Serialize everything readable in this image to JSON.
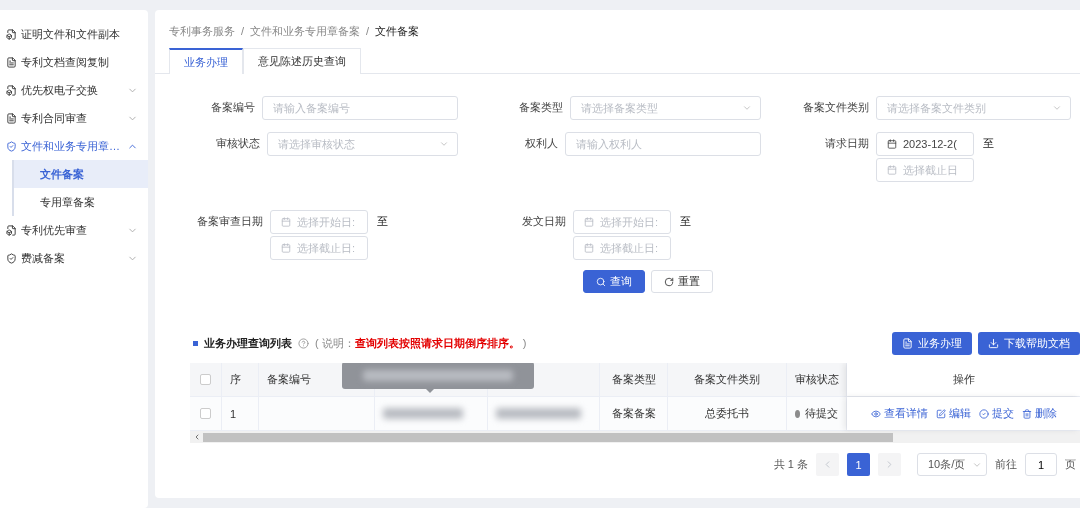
{
  "sidebar": {
    "items": [
      {
        "label": "证明文件和文件副本",
        "selected": false
      },
      {
        "label": "专利文档查阅复制",
        "selected": false
      },
      {
        "label": "优先权电子交换",
        "selected": false,
        "expanded": false
      },
      {
        "label": "专利合同审查",
        "selected": false,
        "expanded": false
      },
      {
        "label": "文件和业务专用章…",
        "selected": true,
        "expanded": true,
        "children": [
          {
            "label": "文件备案",
            "selected": true
          },
          {
            "label": "专用章备案",
            "selected": false
          }
        ]
      },
      {
        "label": "专利优先审查",
        "selected": false,
        "expanded": false
      },
      {
        "label": "费减备案",
        "selected": false,
        "expanded": false
      }
    ]
  },
  "breadcrumb": {
    "items": [
      "专利事务服务",
      "文件和业务专用章备案",
      "文件备案"
    ],
    "separator": "/"
  },
  "tabs": [
    {
      "label": "业务办理",
      "selected": true
    },
    {
      "label": "意见陈述历史查询",
      "selected": false
    }
  ],
  "form": {
    "rows": [
      [
        {
          "label": "备案编号",
          "kind": "text",
          "placeholder": "请输入备案编号"
        },
        {
          "label": "备案类型",
          "kind": "select",
          "placeholder": "请选择备案类型"
        },
        {
          "label": "备案文件类别",
          "kind": "select",
          "placeholder": "请选择备案文件类别"
        }
      ],
      [
        {
          "label": "审核状态",
          "kind": "select",
          "placeholder": "请选择审核状态"
        },
        {
          "label": "权利人",
          "kind": "text",
          "placeholder": "请输入权利人"
        },
        {
          "label": "请求日期",
          "kind": "range",
          "start": {
            "value": "2023-12-2("
          },
          "end": {
            "placeholder": "选择截止日"
          },
          "sep": "至"
        }
      ],
      [
        {
          "label": "备案审查日期",
          "kind": "range",
          "start": {
            "placeholder": "选择开始日:"
          },
          "end": {
            "placeholder": "选择截止日:"
          },
          "sep": "至"
        },
        {
          "label": "发文日期",
          "kind": "range",
          "start": {
            "placeholder": "选择开始日:"
          },
          "end": {
            "placeholder": "选择截止日:"
          },
          "sep": "至"
        }
      ]
    ],
    "buttons": [
      {
        "label": "查询",
        "kind": "primary"
      },
      {
        "label": "重置",
        "kind": "default"
      }
    ]
  },
  "list": {
    "title": "业务办理查询列表",
    "note_prefix": "( 说明：",
    "note": "查询列表按照请求日期倒序排序。",
    "note_suffix": ")",
    "buttons": [
      "业务办理",
      "下载帮助文档"
    ]
  },
  "table": {
    "header_checked": false,
    "columns": [
      "序",
      "备案编号",
      "",
      "",
      "备案类型",
      "备案文件类别",
      "审核状态",
      "操作"
    ],
    "rows": [
      {
        "checked": false,
        "index": "1",
        "type": "备案备案",
        "category": "总委托书",
        "status": "待提交",
        "actions": [
          "查看详情",
          "编辑",
          "提交",
          "删除"
        ]
      }
    ]
  },
  "pagination": {
    "total": "共 1 条",
    "pages": [
      {
        "label": "1",
        "selected": true
      }
    ],
    "page_size": "10条/页",
    "goto_label": "前往",
    "goto_value": "1",
    "goto_suffix": "页"
  }
}
